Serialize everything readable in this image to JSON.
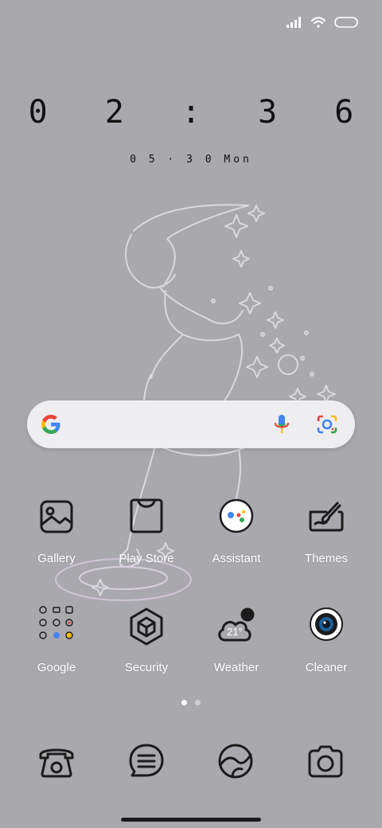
{
  "clock": {
    "time": "0 2 : 3 6",
    "date": "0 5 · 3 0  Mon"
  },
  "status_bar": {
    "signal_icon": "signal-bars-icon",
    "wifi_icon": "wifi-icon",
    "battery_icon": "battery-icon"
  },
  "search": {
    "logo": "google-g-icon",
    "mic": "microphone-icon",
    "lens": "google-lens-icon"
  },
  "apps_row1": [
    {
      "label": "Gallery",
      "icon": "gallery-icon"
    },
    {
      "label": "Play Store",
      "icon": "play-store-icon"
    },
    {
      "label": "Assistant",
      "icon": "assistant-icon"
    },
    {
      "label": "Themes",
      "icon": "themes-icon"
    }
  ],
  "apps_row2": [
    {
      "label": "Google",
      "icon": "google-folder-icon"
    },
    {
      "label": "Security",
      "icon": "security-icon"
    },
    {
      "label": "Weather",
      "icon": "weather-icon",
      "temp": "21°"
    },
    {
      "label": "Cleaner",
      "icon": "cleaner-icon"
    }
  ],
  "page_indicator": {
    "pages": 2,
    "active": 1
  },
  "dock": [
    {
      "icon": "phone-icon"
    },
    {
      "icon": "messages-icon"
    },
    {
      "icon": "browser-icon"
    },
    {
      "icon": "camera-icon"
    }
  ],
  "colors": {
    "background": "#a9a8ad",
    "label": "#ffffff",
    "line": "#1b1b1b"
  }
}
